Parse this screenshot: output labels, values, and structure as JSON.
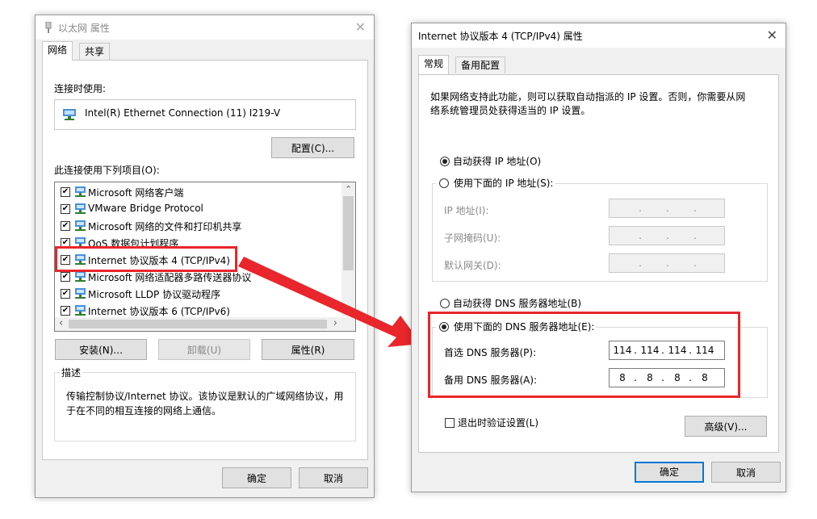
{
  "left_window": {
    "title": "以太网 属性",
    "tabs": [
      "网络",
      "共享"
    ],
    "connect_using_label": "连接时使用:",
    "adapter_name": "Intel(R) Ethernet Connection (11) I219-V",
    "configure_button": "配置(C)...",
    "items_label": "此连接使用下列项目(O):",
    "items": [
      {
        "label": "Microsoft 网络客户端"
      },
      {
        "label": "VMware Bridge Protocol"
      },
      {
        "label": "Microsoft 网络的文件和打印机共享"
      },
      {
        "label": "QoS 数据包计划程序"
      },
      {
        "label": "Internet 协议版本 4 (TCP/IPv4)"
      },
      {
        "label": "Microsoft 网络适配器多路传送器协议"
      },
      {
        "label": "Microsoft LLDP 协议驱动程序"
      },
      {
        "label": "Internet 协议版本 6 (TCP/IPv6)"
      }
    ],
    "install_button": "安装(N)...",
    "uninstall_button": "卸载(U)",
    "properties_button": "属性(R)",
    "description_label": "描述",
    "description_text_1": "传输控制协议/Internet 协议。该协议是默认的广域网络协议，用",
    "description_text_2": "于在不同的相互连接的网络上通信。",
    "ok_button": "确定",
    "cancel_button": "取消"
  },
  "right_window": {
    "title": "Internet 协议版本 4 (TCP/IPv4) 属性",
    "tabs": [
      "常规",
      "备用配置"
    ],
    "intro_line_1": "如果网络支持此功能，则可以获取自动指派的 IP 设置。否则，你需要从网",
    "intro_line_2": "络系统管理员处获得适当的 IP 设置。",
    "auto_ip_label": "自动获得 IP 地址(O)",
    "manual_ip_label": "使用下面的 IP 地址(S):",
    "ip_address_label": "IP 地址(I):",
    "subnet_label": "子网掩码(U):",
    "gateway_label": "默认网关(D):",
    "auto_dns_label": "自动获得 DNS 服务器地址(B)",
    "manual_dns_label": "使用下面的 DNS 服务器地址(E):",
    "preferred_dns_label": "首选 DNS 服务器(P):",
    "preferred_dns": [
      "114",
      "114",
      "114",
      "114"
    ],
    "alternate_dns_label": "备用 DNS 服务器(A):",
    "alternate_dns": [
      "8",
      "8",
      "8",
      "8"
    ],
    "validate_label": "退出时验证设置(L)",
    "advanced_button": "高级(V)...",
    "ok_button": "确定",
    "cancel_button": "取消",
    "dot": "."
  },
  "colors": {
    "highlight_box": "#e8262b",
    "arrow": "#e8262b",
    "focus_blue": "#0078d7"
  },
  "icons": {
    "close": "✕",
    "check": "✔",
    "scroll_up": "⌃",
    "scroll_left": "‹",
    "scroll_right": "›"
  }
}
